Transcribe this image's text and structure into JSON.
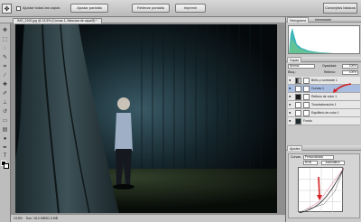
{
  "options_bar": {
    "tool_icon": "move-tool-icon",
    "checkbox_label": "Ajustar todas las capas",
    "buttons": [
      "Ajustar pantalla",
      "Rellenar pantalla",
      "Imprimir"
    ],
    "workspace": "Conceptos básicos"
  },
  "document": {
    "tab_label": "IMG_2162.jpg @ 13,5% (Curvas 1, Máscara de capa/8) *"
  },
  "status": {
    "zoom": "13,5%",
    "doc_size": "Doc: 18,0 MB/51,3 MB"
  },
  "panels": {
    "top_tabs": [
      "Histograma",
      "Información"
    ],
    "layers_tab": "Capas",
    "blend_mode": "Normal",
    "opacity_label": "Opacidad:",
    "opacity_value": "100%",
    "fill_label": "Relleno:",
    "fill_value": "100%",
    "lock_label": "Bloq.:",
    "layers": [
      {
        "name": "Brillo y contraste 1",
        "selected": false
      },
      {
        "name": "Curvas 1",
        "selected": true
      },
      {
        "name": "Relleno de color 1",
        "selected": false
      },
      {
        "name": "Tono/saturación 1",
        "selected": false
      },
      {
        "name": "Equilibrio de color 1",
        "selected": false
      },
      {
        "name": "Fondo",
        "selected": false
      }
    ],
    "adjust_tab": "Ajustes",
    "curves_title": "Curvas",
    "curves_preset": "Personalizado",
    "channel": "RGB",
    "auto_label": "Automático"
  },
  "colors": {
    "accent_red": "#d42020",
    "layer_selected": "#a8bde0"
  }
}
